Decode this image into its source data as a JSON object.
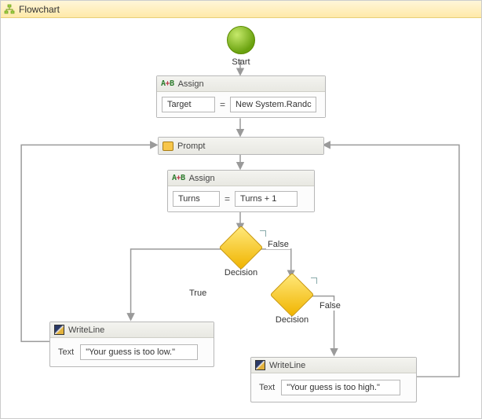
{
  "title": "Flowchart",
  "start": {
    "label": "Start"
  },
  "assign1": {
    "header": "Assign",
    "target": "Target",
    "value": "New System.Randc"
  },
  "prompt": {
    "header": "Prompt"
  },
  "assign2": {
    "header": "Assign",
    "target": "Turns",
    "value": "Turns + 1"
  },
  "decision1": {
    "label": "Decision",
    "trueLabel": "True",
    "falseLabel": "False"
  },
  "decision2": {
    "label": "Decision",
    "falseLabel": "False"
  },
  "writeLow": {
    "header": "WriteLine",
    "propLabel": "Text",
    "value": "\"Your guess is too low.\""
  },
  "writeHigh": {
    "header": "WriteLine",
    "propLabel": "Text",
    "value": "\"Your guess is too high.\""
  }
}
